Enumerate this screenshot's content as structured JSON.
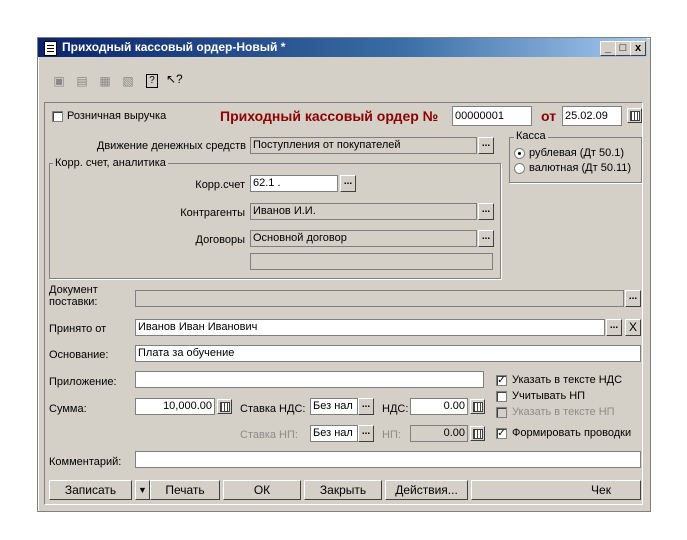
{
  "window": {
    "title": "Приходный кассовый ордер-Новый *"
  },
  "header": {
    "retail_label": "Розничная выручка",
    "doc_title": "Приходный кассовый ордер №",
    "doc_number": "00000001",
    "from_label": "от",
    "doc_date": "25.02.09"
  },
  "cash": {
    "group_title": "Касса",
    "rub_label": "рублевая (Дт 50.1)",
    "val_label": "валютная (Дт 50.11)"
  },
  "movement": {
    "label": "Движение денежных средств",
    "value": "Поступления от покупателей"
  },
  "corr": {
    "group_title": "Корр. счет, аналитика",
    "account_label": "Корр.счет",
    "account_value": "62.1 .",
    "counterparty_label": "Контрагенты",
    "counterparty_value": "Иванов И.И.",
    "contract_label": "Договоры",
    "contract_value": "Основной договор",
    "extra_value": ""
  },
  "form": {
    "supply_doc_label_1": "Документ",
    "supply_doc_label_2": "поставки:",
    "supply_doc_value": "",
    "received_from_label": "Принято от",
    "received_from_value": "Иванов Иван Иванович",
    "basis_label": "Основание:",
    "basis_value": "Плата за обучение",
    "attachment_label": "Приложение:",
    "attachment_value": "",
    "sum_label": "Сумма:",
    "sum_value": "10,000.00",
    "vat_rate_label": "Ставка НДС:",
    "vat_rate_value": "Без нал",
    "vat_label": "НДС:",
    "vat_value": "0.00",
    "np_rate_label": "Ставка НП:",
    "np_rate_value": "Без нал",
    "np_label": "НП:",
    "np_value": "0.00",
    "comment_label": "Комментарий:",
    "comment_value": ""
  },
  "options": {
    "vat_in_text": "Указать в тексте НДС",
    "account_np": "Учитывать НП",
    "np_in_text": "Указать в тексте НП",
    "make_entries": "Формировать проводки"
  },
  "buttons": {
    "save": "Записать",
    "print": "Печать",
    "ok": "ОК",
    "close": "Закрыть",
    "actions": "Действия...",
    "receipt": "Чек"
  }
}
